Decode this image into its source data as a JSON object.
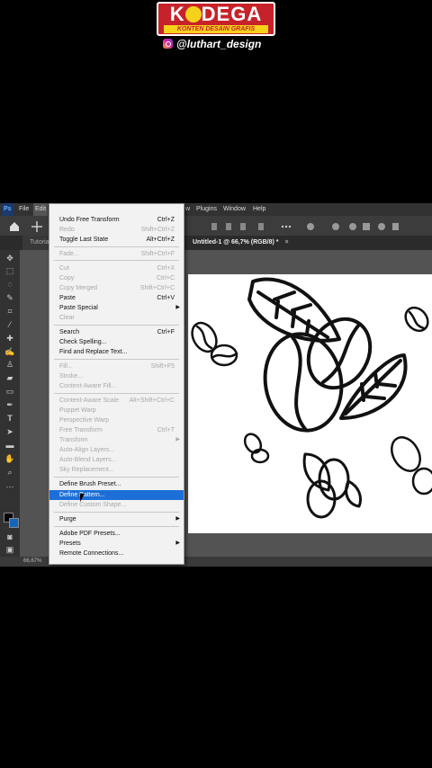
{
  "brand": {
    "logo_text": "KODEGA",
    "tagline": "KONTEN DESAIN GRAFIS",
    "handle": "@luthart_design"
  },
  "app": {
    "logo": "Ps",
    "menubar": [
      "File",
      "Edit",
      "w",
      "Plugins",
      "Window",
      "Help"
    ],
    "tabs": {
      "left_tab": "Tutorial",
      "active_doc": "Untitled-1 @ 66,7% (RGB/8) *",
      "close": "×"
    },
    "status_zoom": "66,67%"
  },
  "edit_menu": {
    "undo": {
      "label": "Undo Free Transform",
      "shortcut": "Ctrl+Z"
    },
    "redo": {
      "label": "Redo",
      "shortcut": "Shift+Ctrl+Z"
    },
    "toggle_last": {
      "label": "Toggle Last State",
      "shortcut": "Alt+Ctrl+Z"
    },
    "fade": {
      "label": "Fade...",
      "shortcut": "Shift+Ctrl+F"
    },
    "cut": {
      "label": "Cut",
      "shortcut": "Ctrl+X"
    },
    "copy": {
      "label": "Copy",
      "shortcut": "Ctrl+C"
    },
    "copy_merged": {
      "label": "Copy Merged",
      "shortcut": "Shift+Ctrl+C"
    },
    "paste": {
      "label": "Paste",
      "shortcut": "Ctrl+V"
    },
    "paste_special": {
      "label": "Paste Special"
    },
    "clear": {
      "label": "Clear"
    },
    "search": {
      "label": "Search",
      "shortcut": "Ctrl+F"
    },
    "check_spelling": {
      "label": "Check Spelling..."
    },
    "find_replace": {
      "label": "Find and Replace Text..."
    },
    "fill": {
      "label": "Fill...",
      "shortcut": "Shift+F5"
    },
    "stroke": {
      "label": "Stroke..."
    },
    "content_aware_fill": {
      "label": "Content-Aware Fill..."
    },
    "content_aware_scale": {
      "label": "Content-Aware Scale",
      "shortcut": "Alt+Shift+Ctrl+C"
    },
    "puppet_warp": {
      "label": "Puppet Warp"
    },
    "perspective_warp": {
      "label": "Perspective Warp"
    },
    "free_transform": {
      "label": "Free Transform",
      "shortcut": "Ctrl+T"
    },
    "transform": {
      "label": "Transform"
    },
    "auto_align": {
      "label": "Auto-Align Layers..."
    },
    "auto_blend": {
      "label": "Auto-Blend Layers..."
    },
    "sky_replacement": {
      "label": "Sky Replacement..."
    },
    "define_brush": {
      "label": "Define Brush Preset..."
    },
    "define_pattern": {
      "label": "Define Pattern..."
    },
    "define_shape": {
      "label": "Define Custom Shape..."
    },
    "purge": {
      "label": "Purge"
    },
    "adobe_pdf": {
      "label": "Adobe PDF Presets..."
    },
    "presets": {
      "label": "Presets"
    },
    "remote": {
      "label": "Remote Connections..."
    }
  },
  "colors": {
    "highlight": "#1d6fd8",
    "brand_red": "#c7222a",
    "brand_yellow": "#f7d21b",
    "fg_swatch": "#000000",
    "bg_swatch": "#1565c0"
  },
  "icons": [
    "home-icon",
    "move-icon",
    "marquee-icon",
    "lasso-icon",
    "crop-icon",
    "brush-icon",
    "stamp-icon",
    "eraser-icon",
    "pen-icon",
    "type-icon",
    "hand-icon",
    "zoom-icon"
  ]
}
